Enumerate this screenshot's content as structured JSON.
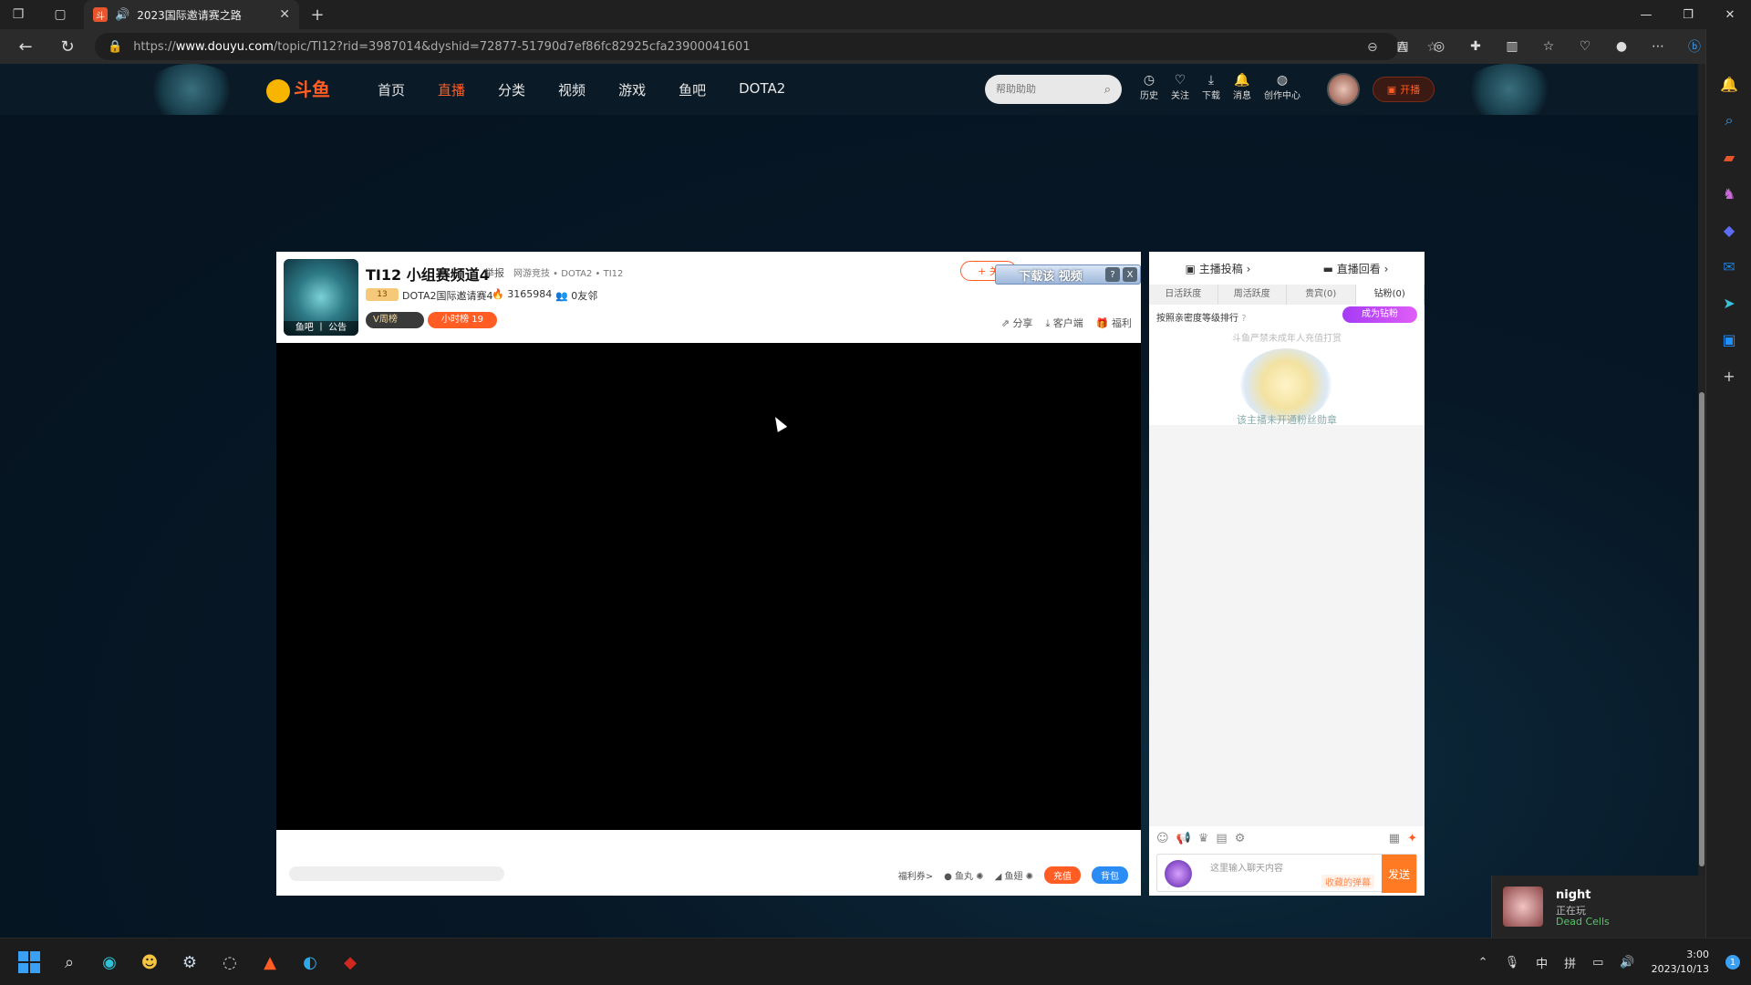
{
  "browser": {
    "tab_title": "2023国际邀请赛之路",
    "url_prefix": "https://",
    "url_host": "www.douyu.com",
    "url_path": "/topic/TI12?rid=3987014&dyshid=72877-51790d7ef86fc82925cfa23900041601"
  },
  "site": {
    "logo_text": "斗鱼",
    "nav": [
      "首页",
      "直播",
      "分类",
      "视频",
      "游戏",
      "鱼吧",
      "DOTA2"
    ],
    "nav_active": "直播",
    "search_placeholder": "帮助助助",
    "header_icons": [
      "历史",
      "关注",
      "下载",
      "消息",
      "创作中心"
    ],
    "live_button": "开播"
  },
  "room": {
    "title": "TI12 小组赛频道4",
    "report": "举报",
    "category": "网游竞技 • DOTA2 • TI12",
    "level": "13",
    "anchor": "DOTA2国际邀请赛4",
    "hot": "3165984",
    "friends": "0友邻",
    "avatar_caption": "鱼吧 丨 公告",
    "v_badge": "V周榜",
    "hour_rank": "小时榜 19",
    "follow": "+ 关",
    "download_bar": "下载该 视频",
    "download_q": "?",
    "download_close": "X",
    "actions": [
      "分享",
      "客户端",
      "福利"
    ]
  },
  "player_foot": {
    "welfare": "福利券>",
    "fishball": "鱼丸",
    "fishwing": "鱼翅",
    "recharge": "充值",
    "backpack": "背包"
  },
  "chat": {
    "contribute": "主播投稿",
    "replay": "直播回看",
    "tabs": [
      "日活跃度",
      "周活跃度",
      "贵宾(0)",
      "钻粉(0)"
    ],
    "rank_hint": "按照亲密度等级排行",
    "fan_button": "成为钻粉",
    "notice": "斗鱼严禁未成年人充值打赏",
    "notice2": "该主播未开通粉丝勋章",
    "input_placeholder": "这里输入聊天内容",
    "fav_danmu": "收藏的弹幕",
    "send": "发送"
  },
  "toast": {
    "name": "night",
    "status": "正在玩",
    "game": "Dead Cells"
  },
  "taskbar": {
    "lang1": "中",
    "lang2": "拼",
    "time": "3:00",
    "date": "2023/10/13",
    "badge": "1"
  }
}
